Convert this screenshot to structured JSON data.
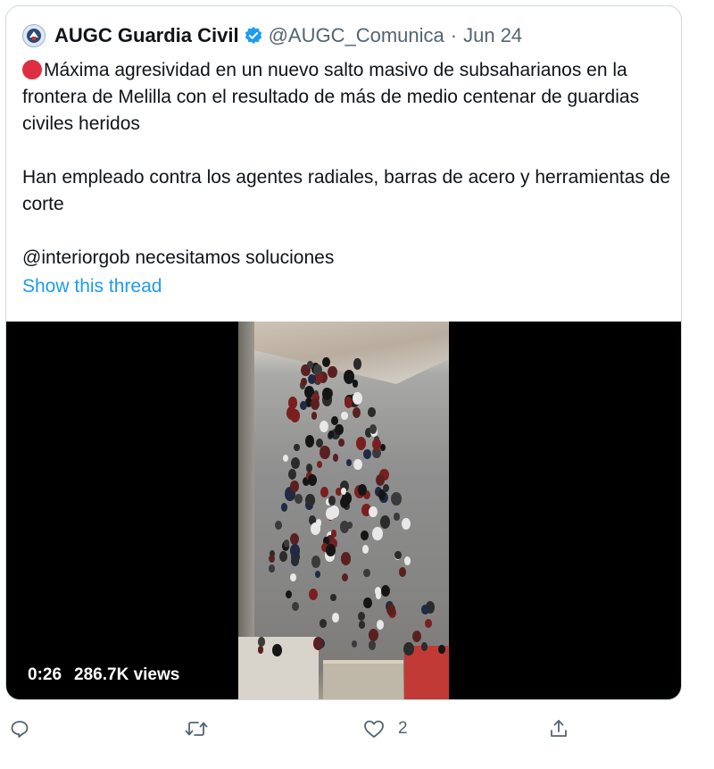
{
  "tweet": {
    "display_name": "AUGC Guardia Civil",
    "handle": "@AUGC_Comunica",
    "separator": "·",
    "date": "Jun 24",
    "paragraph_1": "Máxima agresividad en un nuevo salto masivo de subsaharianos en la frontera de Melilla con el resultado de más de medio centenar de guardias civiles heridos",
    "paragraph_2": "Han empleado contra los agentes radiales, barras de acero y herramientas de corte",
    "paragraph_3": "@interiorgob necesitamos soluciones",
    "show_thread": "Show this thread"
  },
  "video": {
    "duration": "0:26",
    "views": "286.7K views"
  },
  "actions": {
    "like_count": "2"
  },
  "icons": {
    "avatar": "augc-logo-icon",
    "verified": "verified-badge-icon",
    "emoji": "red-circle-icon",
    "reply": "reply-icon",
    "retweet": "retweet-icon",
    "like": "heart-icon",
    "share": "share-icon"
  },
  "colors": {
    "accent": "#1d9bf0",
    "text": "#0f1419",
    "secondary": "#536471",
    "red_emoji": "#dd2e44"
  }
}
